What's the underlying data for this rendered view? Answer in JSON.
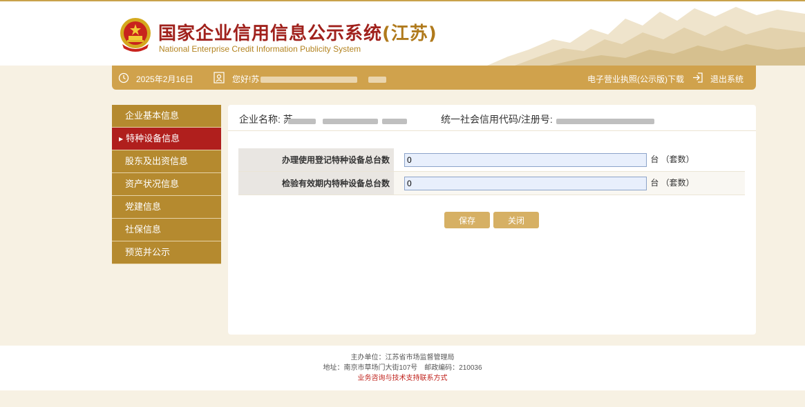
{
  "header": {
    "title_main": "国家企业信用信息公示系统",
    "title_province": "(江苏)",
    "title_en": "National Enterprise Credit Information Publicity System"
  },
  "infobar": {
    "date": "2025年2月16日",
    "greeting": "您好!苏",
    "download_label": "电子营业执照(公示版)下载",
    "logout_label": "退出系统"
  },
  "sidebar": {
    "items": [
      {
        "label": "企业基本信息",
        "active": false
      },
      {
        "label": "特种设备信息",
        "active": true
      },
      {
        "label": "股东及出资信息",
        "active": false
      },
      {
        "label": "资产状况信息",
        "active": false
      },
      {
        "label": "党建信息",
        "active": false
      },
      {
        "label": "社保信息",
        "active": false
      },
      {
        "label": "预览并公示",
        "active": false
      }
    ]
  },
  "main": {
    "company_name_label": "企业名称: 苏",
    "credit_code_label": "统一社会信用代码/注册号:",
    "rows": [
      {
        "label": "办理使用登记特种设备总台数",
        "value": "0",
        "unit": "台 （套数）"
      },
      {
        "label": "检验有效期内特种设备总台数",
        "value": "0",
        "unit": "台 （套数）"
      }
    ],
    "save_label": "保存",
    "close_label": "关闭"
  },
  "footer": {
    "sponsor": "主办单位：江苏省市场监督管理局",
    "address": "地址：南京市草场门大街107号　邮政编码：210036",
    "support_link": "业务咨询与技术支持联系方式"
  },
  "colors": {
    "accent_gold": "#d0a24c",
    "sidebar_gold": "#b58a2f",
    "active_red": "#b01f1d",
    "title_red": "#a0211c"
  },
  "icons": [
    "national-emblem-icon",
    "clock-icon",
    "user-icon",
    "logout-icon"
  ]
}
